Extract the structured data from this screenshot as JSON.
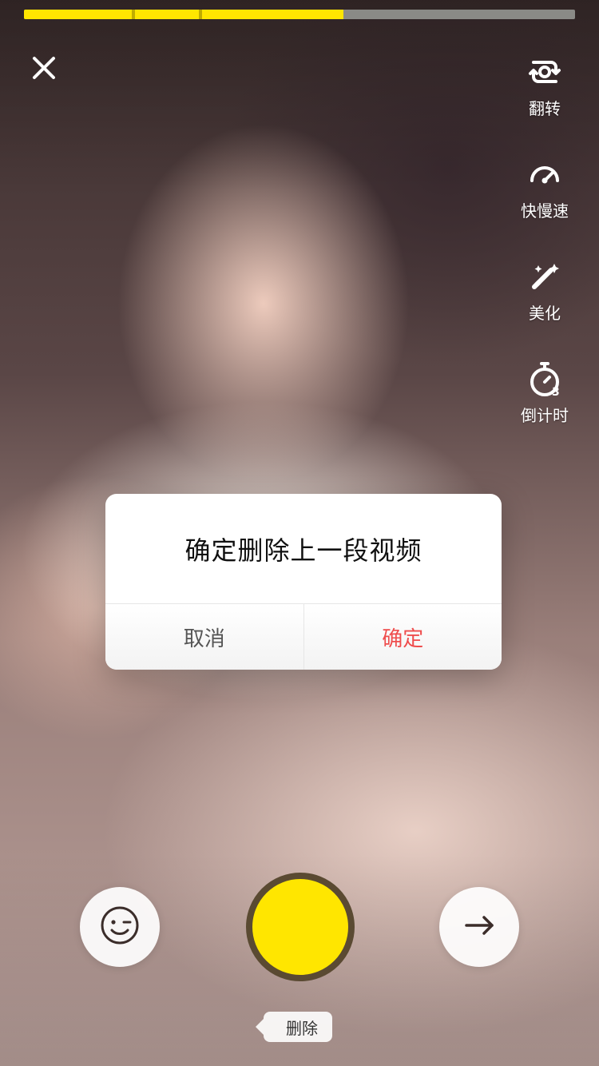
{
  "progress": {
    "filled_fraction": 0.58,
    "segment_breaks": [
      0.195,
      0.318
    ],
    "colors": {
      "filled": "#ffe600",
      "remaining": "#8a8a86"
    }
  },
  "top_bar": {
    "close_icon": "close-icon"
  },
  "tools": [
    {
      "id": "flip",
      "icon": "flip-camera-icon",
      "label": "翻转"
    },
    {
      "id": "speed",
      "icon": "speedometer-icon",
      "label": "快慢速"
    },
    {
      "id": "beauty",
      "icon": "magic-wand-icon",
      "label": "美化"
    },
    {
      "id": "timer",
      "icon": "timer-3-icon",
      "label": "倒计时"
    }
  ],
  "dialog": {
    "message": "确定删除上一段视频",
    "cancel_label": "取消",
    "confirm_label": "确定",
    "confirm_color": "#ef4d4d"
  },
  "bottom": {
    "emoji_icon": "smile-icon",
    "next_icon": "arrow-right-icon",
    "record_color": "#ffe600",
    "delete_label": "删除"
  }
}
